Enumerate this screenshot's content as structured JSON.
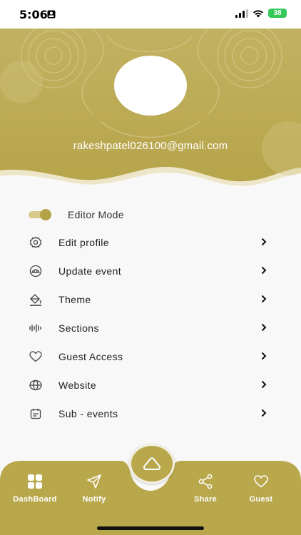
{
  "status_bar": {
    "time": "5:06",
    "battery": "38"
  },
  "profile": {
    "email": "rakeshpatel026100@gmail.com"
  },
  "editor_mode": {
    "label": "Editor Mode",
    "enabled": true
  },
  "menu": [
    {
      "label": "Edit profile",
      "icon": "gear-icon"
    },
    {
      "label": "Update event",
      "icon": "event-icon"
    },
    {
      "label": "Theme",
      "icon": "paint-bucket-icon"
    },
    {
      "label": "Sections",
      "icon": "sections-icon"
    },
    {
      "label": "Guest Access",
      "icon": "heart-icon"
    },
    {
      "label": "Website",
      "icon": "globe-icon"
    },
    {
      "label": "Sub - events",
      "icon": "calendar-icon"
    }
  ],
  "bottom_nav": {
    "dashboard": "DashBoard",
    "notify": "Notify",
    "share": "Share",
    "guest": "Guest"
  },
  "colors": {
    "accent": "#b9a74c",
    "accent_light": "#d8c98a",
    "background": "#f8f8f8"
  }
}
